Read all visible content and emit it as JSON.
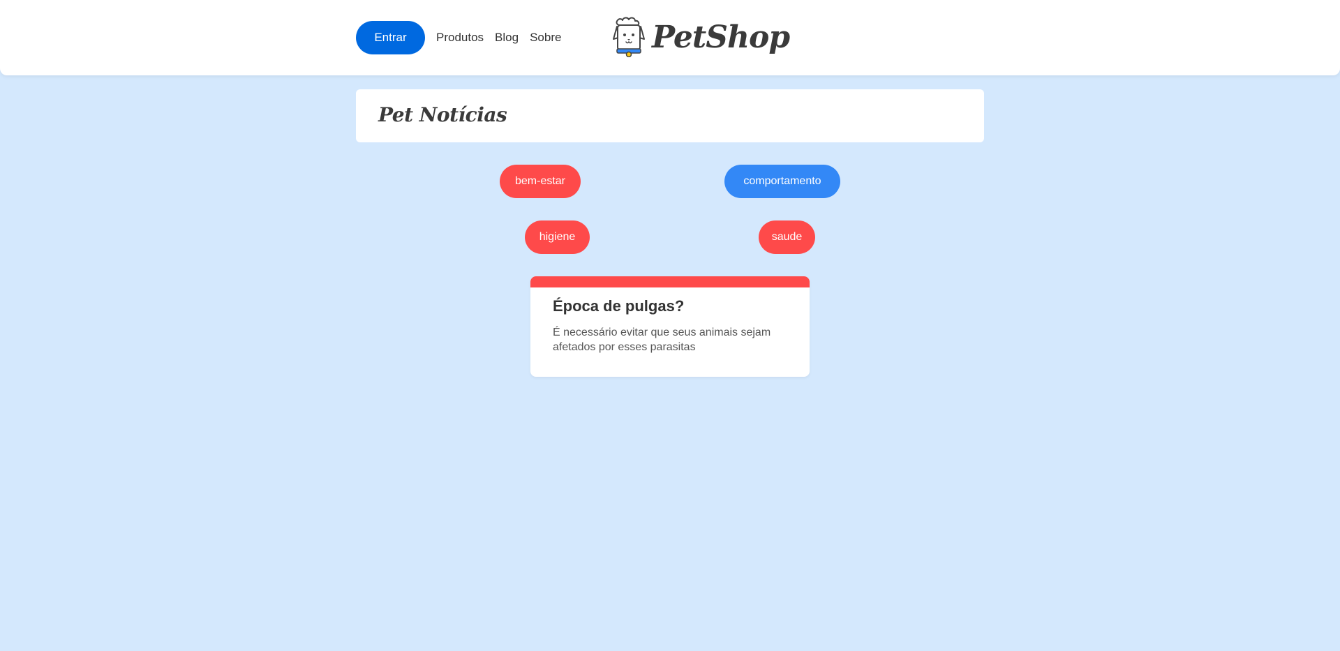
{
  "header": {
    "login_label": "Entrar",
    "nav": [
      {
        "label": "Produtos"
      },
      {
        "label": "Blog"
      },
      {
        "label": "Sobre"
      }
    ],
    "logo_text": "PetShop",
    "logo_icon": "dog-chef-icon"
  },
  "main": {
    "title": "Pet Notícias",
    "tags": [
      {
        "label": "bem-estar",
        "color": "#fe4a4a"
      },
      {
        "label": "comportamento",
        "color": "#3388f6"
      },
      {
        "label": "higiene",
        "color": "#fe4a4a"
      },
      {
        "label": "saude",
        "color": "#fe4a4a"
      }
    ],
    "card": {
      "title": "Época de pulgas?",
      "text": "É necessário evitar que seus animais sejam afetados por esses parasitas",
      "accent": "#fe4a4a"
    }
  },
  "colors": {
    "background": "#d4e8fd",
    "primary": "#0069e0",
    "red": "#fe4a4a",
    "blue": "#3388f6"
  }
}
